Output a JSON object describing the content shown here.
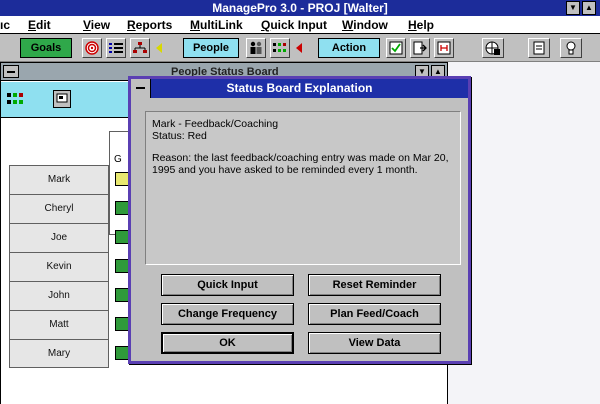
{
  "window": {
    "title": "ManagePro 3.0 - PROJ [Walter]"
  },
  "menu": [
    {
      "pre": "",
      "u": "",
      "post": "ıc"
    },
    {
      "pre": "",
      "u": "E",
      "post": "dit"
    },
    {
      "pre": "",
      "u": "V",
      "post": "iew"
    },
    {
      "pre": "",
      "u": "R",
      "post": "eports"
    },
    {
      "pre": "",
      "u": "M",
      "post": "ultiLink"
    },
    {
      "pre": "",
      "u": "Q",
      "post": "uick Input"
    },
    {
      "pre": "",
      "u": "W",
      "post": "indow"
    },
    {
      "pre": "",
      "u": "H",
      "post": "elp"
    }
  ],
  "toolbar": {
    "goals_label": "Goals",
    "people_label": "People",
    "action_label": "Action",
    "goals_color": "#2fa84a",
    "people_color": "#8fe0f0",
    "action_color": "#8fe0f0"
  },
  "child_window": {
    "title": "People Status Board",
    "header_col": "G",
    "people": [
      "Mark",
      "Cheryl",
      "Joe",
      "Kevin",
      "John",
      "Matt",
      "Mary"
    ],
    "statuses": [
      "yellow",
      "green",
      "green",
      "green",
      "green",
      "green",
      "green"
    ],
    "status_colors": {
      "yellow": "#e8e870",
      "green": "#2f9a3a"
    }
  },
  "dialog": {
    "title": "Status Board Explanation",
    "line1": "Mark - Feedback/Coaching",
    "line2": "Status: Red",
    "reason": "Reason: the last feedback/coaching entry was made on Mar 20, 1995 and you have asked to be reminded every 1 month.",
    "buttons": {
      "quick_input": "Quick Input",
      "reset_reminder": "Reset Reminder",
      "change_frequency": "Change Frequency",
      "plan_feed_coach": "Plan Feed/Coach",
      "ok": "OK",
      "view_data": "View Data"
    }
  }
}
